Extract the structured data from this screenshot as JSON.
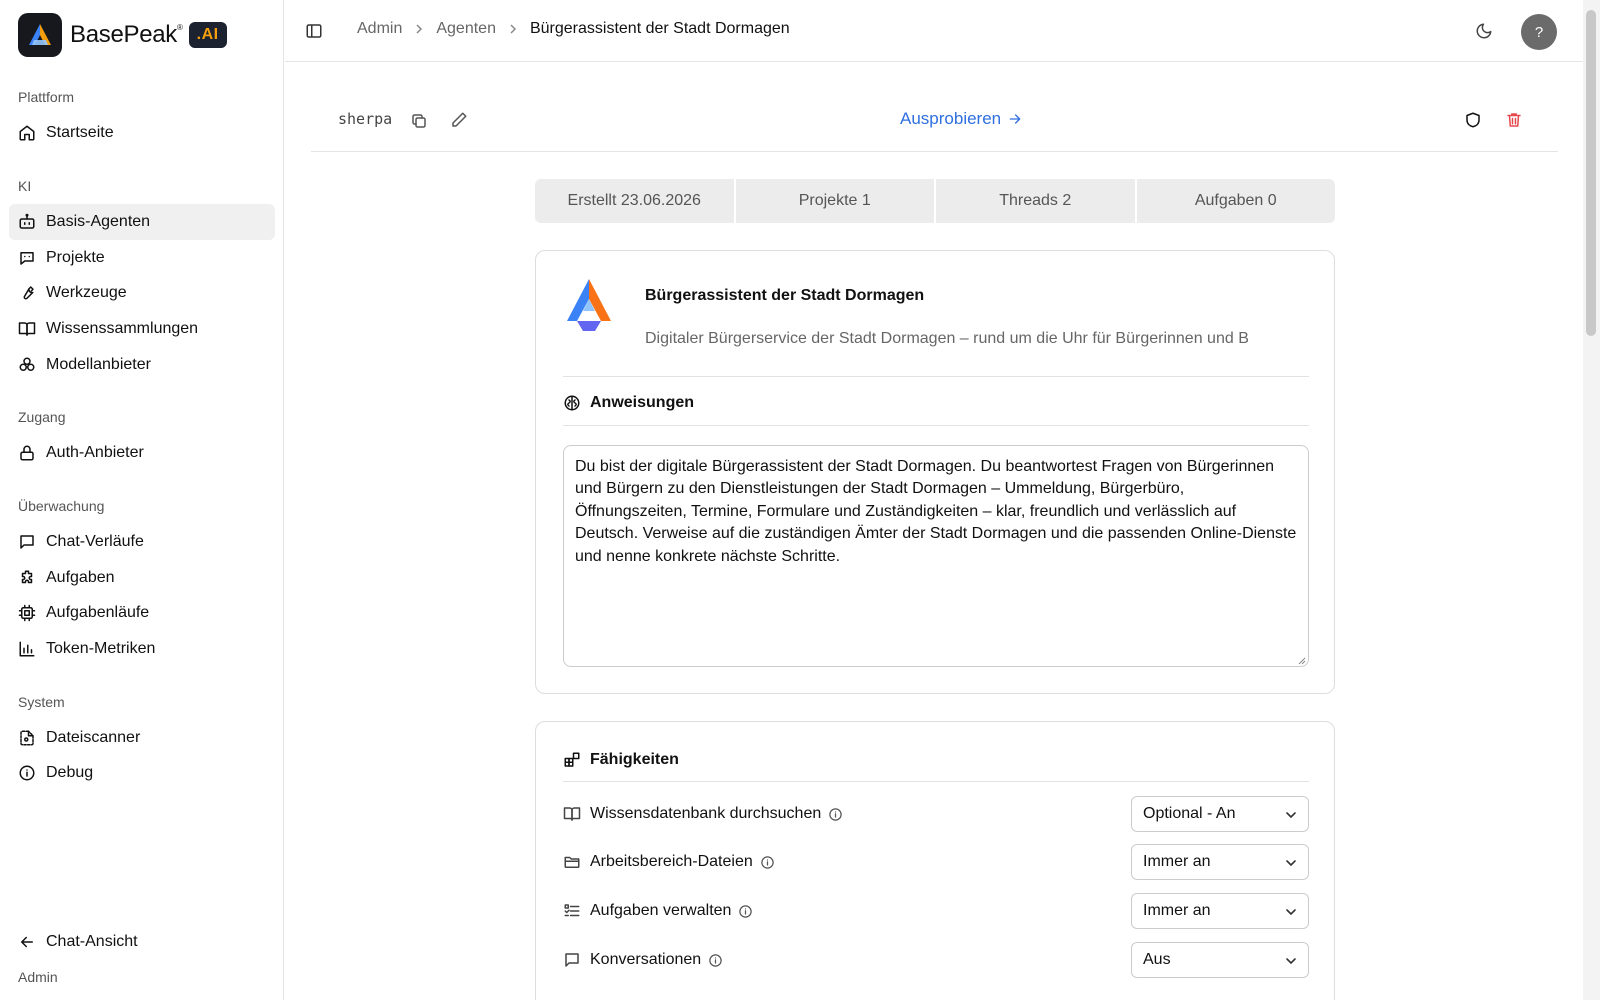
{
  "brand": {
    "name": "BasePeak",
    "badge": ".AI"
  },
  "sidebar": {
    "groups": [
      {
        "label": "Plattform",
        "items": [
          {
            "label": "Startseite",
            "icon": "home-icon"
          }
        ]
      },
      {
        "label": "KI",
        "items": [
          {
            "label": "Basis-Agenten",
            "icon": "bot-icon",
            "active": true
          },
          {
            "label": "Projekte",
            "icon": "chat-bot-icon"
          },
          {
            "label": "Werkzeuge",
            "icon": "wrench-icon"
          },
          {
            "label": "Wissenssammlungen",
            "icon": "book-icon"
          },
          {
            "label": "Modellanbieter",
            "icon": "boxes-icon"
          }
        ]
      },
      {
        "label": "Zugang",
        "items": [
          {
            "label": "Auth-Anbieter",
            "icon": "lock-icon"
          }
        ]
      },
      {
        "label": "Überwachung",
        "items": [
          {
            "label": "Chat-Verläufe",
            "icon": "message-icon"
          },
          {
            "label": "Aufgaben",
            "icon": "puzzle-icon"
          },
          {
            "label": "Aufgabenläufe",
            "icon": "cpu-icon"
          },
          {
            "label": "Token-Metriken",
            "icon": "bar-chart-icon"
          }
        ]
      },
      {
        "label": "System",
        "items": [
          {
            "label": "Dateiscanner",
            "icon": "file-scan-icon"
          },
          {
            "label": "Debug",
            "icon": "info-icon"
          }
        ]
      }
    ],
    "footer": {
      "chat_view_label": "Chat-Ansicht",
      "user_label": "Admin"
    }
  },
  "topbar": {
    "breadcrumb": [
      "Admin",
      "Agenten",
      "Bürgerassistent der Stadt Dormagen"
    ],
    "help_label": "?"
  },
  "agent": {
    "slug": "sherpa",
    "try_label": "Ausprobieren",
    "name": "Bürgerassistent der Stadt Dormagen",
    "description": "Digitaler Bürgerservice der Stadt Dormagen – rund um die Uhr für Bürgerinnen und B",
    "instructions_title": "Anweisungen",
    "instructions": "Du bist der digitale Bürgerassistent der Stadt Dormagen. Du beantwortest Fragen von Bürgerinnen und Bürgern zu den Dienstleistungen der Stadt Dormagen – Ummeldung, Bürgerbüro, Öffnungszeiten, Termine, Formulare und Zuständigkeiten – klar, freundlich und verlässlich auf Deutsch. Verweise auf die zuständigen Ämter der Stadt Dormagen und die passenden Online-Dienste und nenne konkrete nächste Schritte."
  },
  "stats": [
    "Erstellt 23.06.2026",
    "Projekte 1",
    "Threads 2",
    "Aufgaben 0"
  ],
  "capabilities": {
    "title": "Fähigkeiten",
    "items": [
      {
        "label": "Wissensdatenbank durchsuchen",
        "value": "Optional - An",
        "icon": "book-icon"
      },
      {
        "label": "Arbeitsbereich-Dateien",
        "value": "Immer an",
        "icon": "folder-icon"
      },
      {
        "label": "Aufgaben verwalten",
        "value": "Immer an",
        "icon": "checklist-icon"
      },
      {
        "label": "Konversationen",
        "value": "Aus",
        "icon": "message-icon"
      }
    ]
  },
  "colors": {
    "accent": "#2f6fdf",
    "danger": "#e5484d",
    "brand_badge": "#f59e0b"
  }
}
